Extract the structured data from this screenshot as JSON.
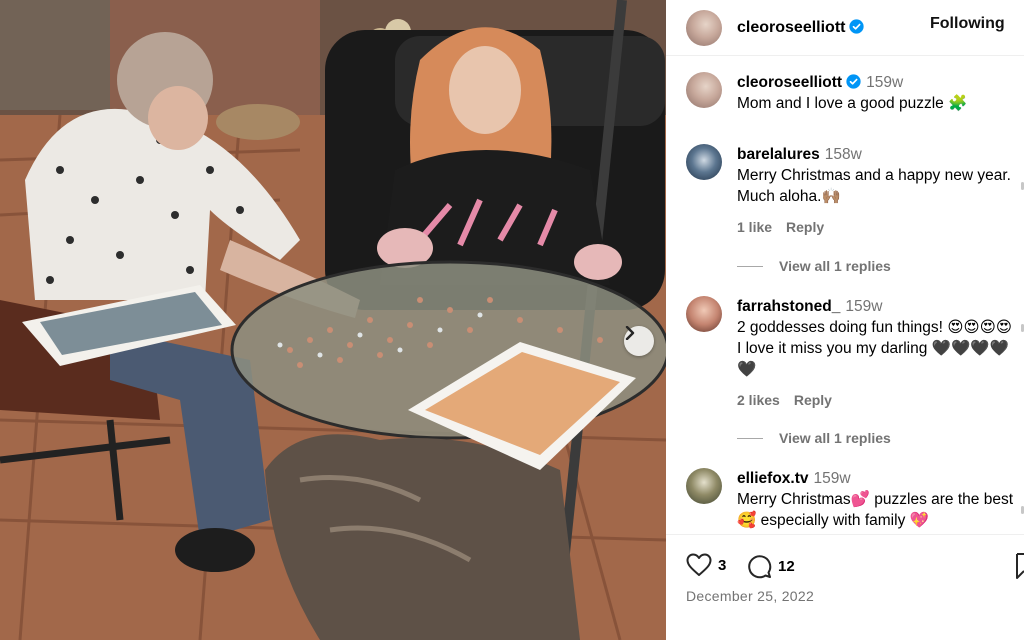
{
  "header": {
    "username": "cleoroseelliott",
    "verified": true,
    "follow_label": "Following"
  },
  "caption": {
    "username": "cleoroseelliott",
    "time": "159w",
    "text": "Mom and I love a good puzzle 🧩"
  },
  "comments": [
    {
      "username": "barelalures",
      "time": "158w",
      "text": "Merry Christmas and a happy new year. Much aloha.🙌🏽",
      "likes_label": "1 like",
      "reply_label": "Reply",
      "view_replies_label": "View all 1 replies"
    },
    {
      "username": "farrahstoned_",
      "time": "159w",
      "text": "2 goddesses doing fun things! 😍😍😍😍 I love it miss you my darling 🖤🖤🖤🖤🖤",
      "likes_label": "2 likes",
      "reply_label": "Reply",
      "view_replies_label": "View all 1 replies"
    },
    {
      "username": "elliefox.tv",
      "time": "159w",
      "text": "Merry Christmas💕 puzzles are the best 🥰 especially with family 💖"
    }
  ],
  "actions": {
    "likes_count": "3",
    "comments_count": "12",
    "date": "December 25, 2022"
  },
  "icons": {
    "verified": "verified-badge-icon",
    "heart": "heart-icon",
    "comment": "comment-icon",
    "bookmark": "bookmark-icon",
    "next": "chevron-right-icon"
  },
  "colors": {
    "verified_blue": "#0095f6",
    "secondary_text": "#737373"
  }
}
